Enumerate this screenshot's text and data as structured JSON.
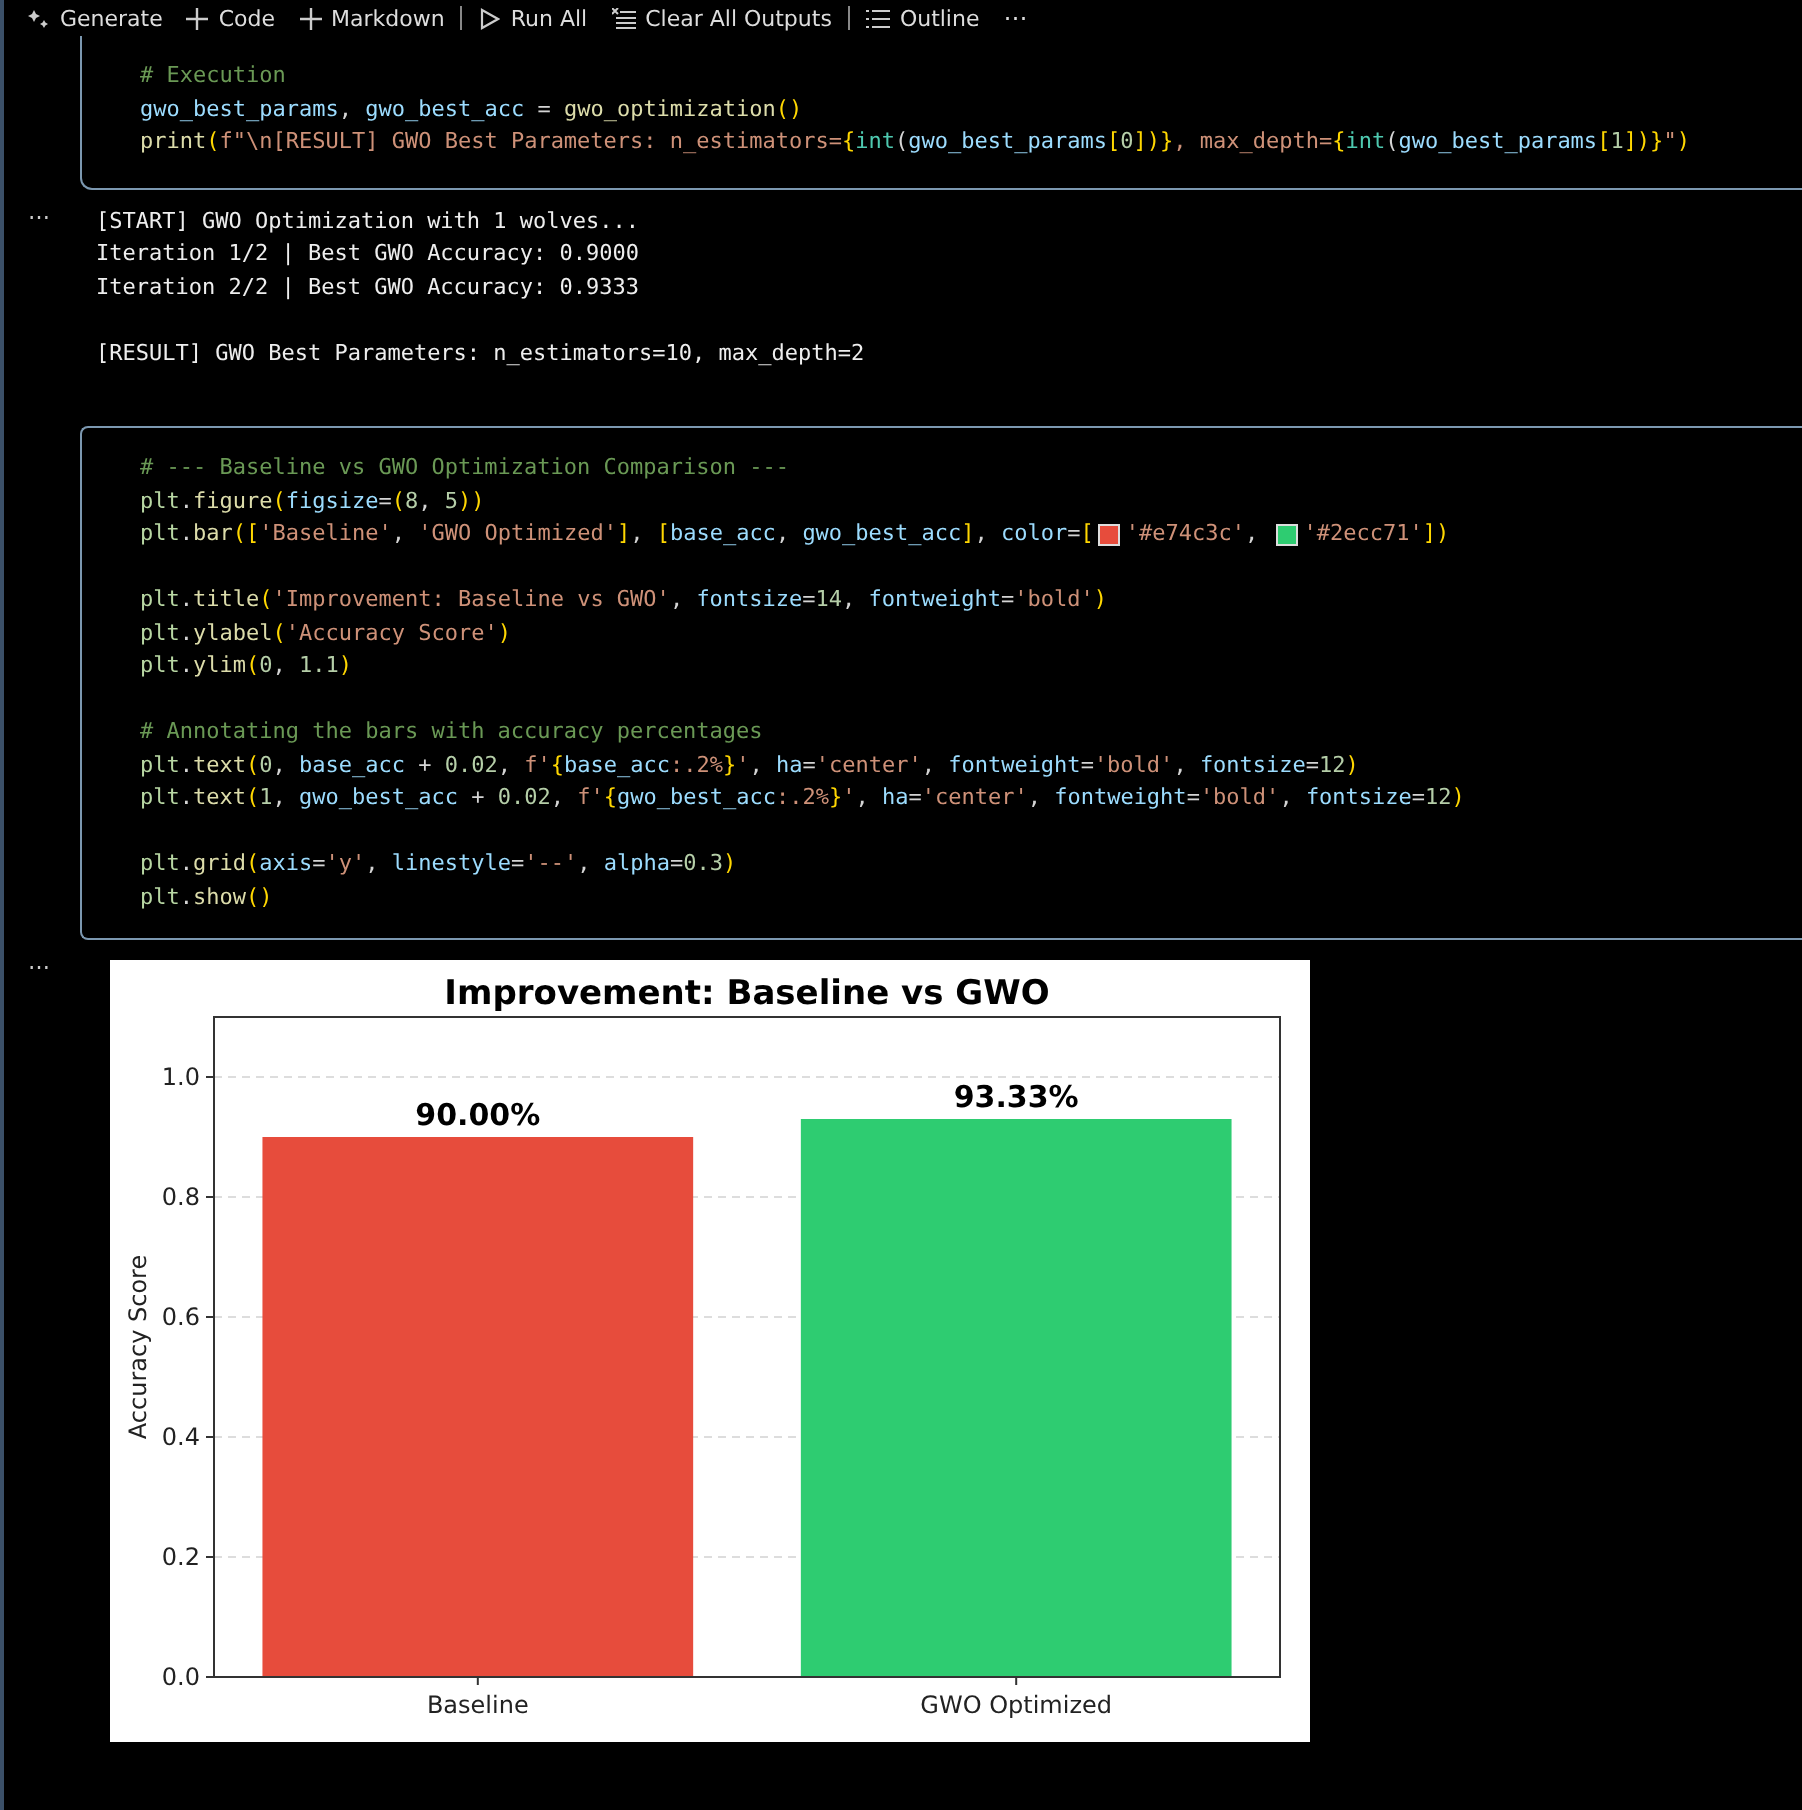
{
  "toolbar": {
    "items": [
      {
        "kind": "sparkle",
        "label": "Generate"
      },
      {
        "kind": "plus",
        "label": "Code"
      },
      {
        "kind": "plus",
        "label": "Markdown"
      },
      {
        "kind": "sep"
      },
      {
        "kind": "play",
        "label": "Run All"
      },
      {
        "kind": "clear",
        "label": "Clear All Outputs"
      },
      {
        "kind": "sep"
      },
      {
        "kind": "list",
        "label": "Outline"
      }
    ],
    "more": "⋯"
  },
  "cells": [
    {
      "code": [
        [
          [
            {
              "kind": "cm",
              "text": "# Execution"
            }
          ],
          [
            {
              "kind": "v",
              "text": "gwo_best_params"
            },
            {
              "kind": "t",
              "text": ", "
            },
            {
              "kind": "v",
              "text": "gwo_best_acc"
            },
            {
              "kind": "t",
              "text": " = "
            },
            {
              "kind": "fn",
              "text": "gwo_optimization"
            },
            {
              "kind": "p",
              "text": "()"
            }
          ],
          [
            {
              "kind": "fn",
              "text": "print"
            },
            {
              "kind": "p",
              "text": "("
            },
            {
              "kind": "s",
              "text": "f\"\\n[RESULT] GWO Best Parameters: n_estimators="
            },
            {
              "kind": "p",
              "text": "{"
            },
            {
              "kind": "kw",
              "text": "int"
            },
            {
              "kind": "t",
              "text": "("
            },
            {
              "kind": "v",
              "text": "gwo_best_params"
            },
            {
              "kind": "p",
              "text": "["
            },
            {
              "kind": "n",
              "text": "0"
            },
            {
              "kind": "p",
              "text": "])}"
            },
            {
              "kind": "s",
              "text": ", max_depth="
            },
            {
              "kind": "p",
              "text": "{"
            },
            {
              "kind": "kw",
              "text": "int"
            },
            {
              "kind": "t",
              "text": "("
            },
            {
              "kind": "v",
              "text": "gwo_best_params"
            },
            {
              "kind": "p",
              "text": "["
            },
            {
              "kind": "n",
              "text": "1"
            },
            {
              "kind": "p",
              "text": "])}"
            },
            {
              "kind": "s",
              "text": "\""
            },
            {
              "kind": "p",
              "text": ")"
            }
          ]
        ]
      ],
      "output": {
        "more": "⋯",
        "kind": "text",
        "blocks": [
          [
            "[START] GWO Optimization with 1 wolves...",
            "Iteration 1/2 | Best GWO Accuracy: 0.9000",
            "Iteration 2/2 | Best GWO Accuracy: 0.9333"
          ],
          [
            "[RESULT] GWO Best Parameters: n_estimators=10, max_depth=2"
          ]
        ]
      }
    },
    {
      "code": [
        [
          [
            {
              "kind": "cm",
              "text": "# --- Baseline vs GWO Optimization Comparison ---"
            }
          ],
          [
            {
              "kind": "m",
              "text": "plt"
            },
            {
              "kind": "t",
              "text": "."
            },
            {
              "kind": "fn",
              "text": "figure"
            },
            {
              "kind": "p",
              "text": "("
            },
            {
              "kind": "v",
              "text": "figsize"
            },
            {
              "kind": "t",
              "text": "="
            },
            {
              "kind": "p",
              "text": "("
            },
            {
              "kind": "n",
              "text": "8"
            },
            {
              "kind": "t",
              "text": ", "
            },
            {
              "kind": "n",
              "text": "5"
            },
            {
              "kind": "p",
              "text": "))"
            }
          ],
          [
            {
              "kind": "m",
              "text": "plt"
            },
            {
              "kind": "t",
              "text": "."
            },
            {
              "kind": "fn",
              "text": "bar"
            },
            {
              "kind": "p",
              "text": "(["
            },
            {
              "kind": "s",
              "text": "'Baseline'"
            },
            {
              "kind": "t",
              "text": ", "
            },
            {
              "kind": "s",
              "text": "'GWO Optimized'"
            },
            {
              "kind": "p",
              "text": "]"
            },
            {
              "kind": "t",
              "text": ", "
            },
            {
              "kind": "p",
              "text": "["
            },
            {
              "kind": "v",
              "text": "base_acc"
            },
            {
              "kind": "t",
              "text": ", "
            },
            {
              "kind": "v",
              "text": "gwo_best_acc"
            },
            {
              "kind": "p",
              "text": "]"
            },
            {
              "kind": "t",
              "text": ", "
            },
            {
              "kind": "v",
              "text": "color"
            },
            {
              "kind": "t",
              "text": "="
            },
            {
              "kind": "p",
              "text": "["
            },
            {
              "kind": "swatch",
              "color": "#e74c3c"
            },
            {
              "kind": "s",
              "text": "'#e74c3c'"
            },
            {
              "kind": "t",
              "text": ", "
            },
            {
              "kind": "swatch",
              "color": "#2ecc71"
            },
            {
              "kind": "s",
              "text": "'#2ecc71'"
            },
            {
              "kind": "p",
              "text": "])"
            }
          ]
        ],
        [
          [
            {
              "kind": "m",
              "text": "plt"
            },
            {
              "kind": "t",
              "text": "."
            },
            {
              "kind": "fn",
              "text": "title"
            },
            {
              "kind": "p",
              "text": "("
            },
            {
              "kind": "s",
              "text": "'Improvement: Baseline vs GWO'"
            },
            {
              "kind": "t",
              "text": ", "
            },
            {
              "kind": "v",
              "text": "fontsize"
            },
            {
              "kind": "t",
              "text": "="
            },
            {
              "kind": "n",
              "text": "14"
            },
            {
              "kind": "t",
              "text": ", "
            },
            {
              "kind": "v",
              "text": "fontweight"
            },
            {
              "kind": "t",
              "text": "="
            },
            {
              "kind": "s",
              "text": "'bold'"
            },
            {
              "kind": "p",
              "text": ")"
            }
          ],
          [
            {
              "kind": "m",
              "text": "plt"
            },
            {
              "kind": "t",
              "text": "."
            },
            {
              "kind": "fn",
              "text": "ylabel"
            },
            {
              "kind": "p",
              "text": "("
            },
            {
              "kind": "s",
              "text": "'Accuracy Score'"
            },
            {
              "kind": "p",
              "text": ")"
            }
          ],
          [
            {
              "kind": "m",
              "text": "plt"
            },
            {
              "kind": "t",
              "text": "."
            },
            {
              "kind": "fn",
              "text": "ylim"
            },
            {
              "kind": "p",
              "text": "("
            },
            {
              "kind": "n",
              "text": "0"
            },
            {
              "kind": "t",
              "text": ", "
            },
            {
              "kind": "n",
              "text": "1.1"
            },
            {
              "kind": "p",
              "text": ")"
            }
          ]
        ],
        [
          [
            {
              "kind": "cm",
              "text": "# Annotating the bars with accuracy percentages"
            }
          ],
          [
            {
              "kind": "m",
              "text": "plt"
            },
            {
              "kind": "t",
              "text": "."
            },
            {
              "kind": "fn",
              "text": "text"
            },
            {
              "kind": "p",
              "text": "("
            },
            {
              "kind": "n",
              "text": "0"
            },
            {
              "kind": "t",
              "text": ", "
            },
            {
              "kind": "v",
              "text": "base_acc"
            },
            {
              "kind": "t",
              "text": " + "
            },
            {
              "kind": "n",
              "text": "0.02"
            },
            {
              "kind": "t",
              "text": ", "
            },
            {
              "kind": "s",
              "text": "f'"
            },
            {
              "kind": "p",
              "text": "{"
            },
            {
              "kind": "v",
              "text": "base_acc"
            },
            {
              "kind": "s",
              "text": ":.2%"
            },
            {
              "kind": "p",
              "text": "}"
            },
            {
              "kind": "s",
              "text": "'"
            },
            {
              "kind": "t",
              "text": ", "
            },
            {
              "kind": "v",
              "text": "ha"
            },
            {
              "kind": "t",
              "text": "="
            },
            {
              "kind": "s",
              "text": "'center'"
            },
            {
              "kind": "t",
              "text": ", "
            },
            {
              "kind": "v",
              "text": "fontweight"
            },
            {
              "kind": "t",
              "text": "="
            },
            {
              "kind": "s",
              "text": "'bold'"
            },
            {
              "kind": "t",
              "text": ", "
            },
            {
              "kind": "v",
              "text": "fontsize"
            },
            {
              "kind": "t",
              "text": "="
            },
            {
              "kind": "n",
              "text": "12"
            },
            {
              "kind": "p",
              "text": ")"
            }
          ],
          [
            {
              "kind": "m",
              "text": "plt"
            },
            {
              "kind": "t",
              "text": "."
            },
            {
              "kind": "fn",
              "text": "text"
            },
            {
              "kind": "p",
              "text": "("
            },
            {
              "kind": "n",
              "text": "1"
            },
            {
              "kind": "t",
              "text": ", "
            },
            {
              "kind": "v",
              "text": "gwo_best_acc"
            },
            {
              "kind": "t",
              "text": " + "
            },
            {
              "kind": "n",
              "text": "0.02"
            },
            {
              "kind": "t",
              "text": ", "
            },
            {
              "kind": "s",
              "text": "f'"
            },
            {
              "kind": "p",
              "text": "{"
            },
            {
              "kind": "v",
              "text": "gwo_best_acc"
            },
            {
              "kind": "s",
              "text": ":.2%"
            },
            {
              "kind": "p",
              "text": "}"
            },
            {
              "kind": "s",
              "text": "'"
            },
            {
              "kind": "t",
              "text": ", "
            },
            {
              "kind": "v",
              "text": "ha"
            },
            {
              "kind": "t",
              "text": "="
            },
            {
              "kind": "s",
              "text": "'center'"
            },
            {
              "kind": "t",
              "text": ", "
            },
            {
              "kind": "v",
              "text": "fontweight"
            },
            {
              "kind": "t",
              "text": "="
            },
            {
              "kind": "s",
              "text": "'bold'"
            },
            {
              "kind": "t",
              "text": ", "
            },
            {
              "kind": "v",
              "text": "fontsize"
            },
            {
              "kind": "t",
              "text": "="
            },
            {
              "kind": "n",
              "text": "12"
            },
            {
              "kind": "p",
              "text": ")"
            }
          ]
        ],
        [
          [
            {
              "kind": "m",
              "text": "plt"
            },
            {
              "kind": "t",
              "text": "."
            },
            {
              "kind": "fn",
              "text": "grid"
            },
            {
              "kind": "p",
              "text": "("
            },
            {
              "kind": "v",
              "text": "axis"
            },
            {
              "kind": "t",
              "text": "="
            },
            {
              "kind": "s",
              "text": "'y'"
            },
            {
              "kind": "t",
              "text": ", "
            },
            {
              "kind": "v",
              "text": "linestyle"
            },
            {
              "kind": "t",
              "text": "="
            },
            {
              "kind": "s",
              "text": "'--'"
            },
            {
              "kind": "t",
              "text": ", "
            },
            {
              "kind": "v",
              "text": "alpha"
            },
            {
              "kind": "t",
              "text": "="
            },
            {
              "kind": "n",
              "text": "0.3"
            },
            {
              "kind": "p",
              "text": ")"
            }
          ],
          [
            {
              "kind": "m",
              "text": "plt"
            },
            {
              "kind": "t",
              "text": "."
            },
            {
              "kind": "fn",
              "text": "show"
            },
            {
              "kind": "p",
              "text": "()"
            }
          ]
        ]
      ],
      "output": {
        "more": "⋯",
        "kind": "chart",
        "chart_data": {
          "type": "bar",
          "title": "Improvement: Baseline vs GWO",
          "ylabel": "Accuracy Score",
          "categories": [
            "Baseline",
            "GWO Optimized"
          ],
          "series": [
            {
              "color": "#e74c3c",
              "values": [
                0.9,
                null
              ]
            },
            {
              "color": "#2ecc71",
              "values": [
                null,
                0.93
              ]
            }
          ],
          "grid": true,
          "ylim": [
            0,
            1.1
          ],
          "yticks": [
            {
              "value": 0,
              "label": "0.0"
            },
            {
              "value": 0.2,
              "label": "0.2"
            },
            {
              "value": 0.4,
              "label": "0.4"
            },
            {
              "value": 0.6,
              "label": "0.6"
            },
            {
              "value": 0.8,
              "label": "0.8"
            },
            {
              "value": 1,
              "label": "1.0"
            }
          ],
          "value_labels": [
            "90.00%",
            "93.33%"
          ]
        }
      }
    }
  ]
}
